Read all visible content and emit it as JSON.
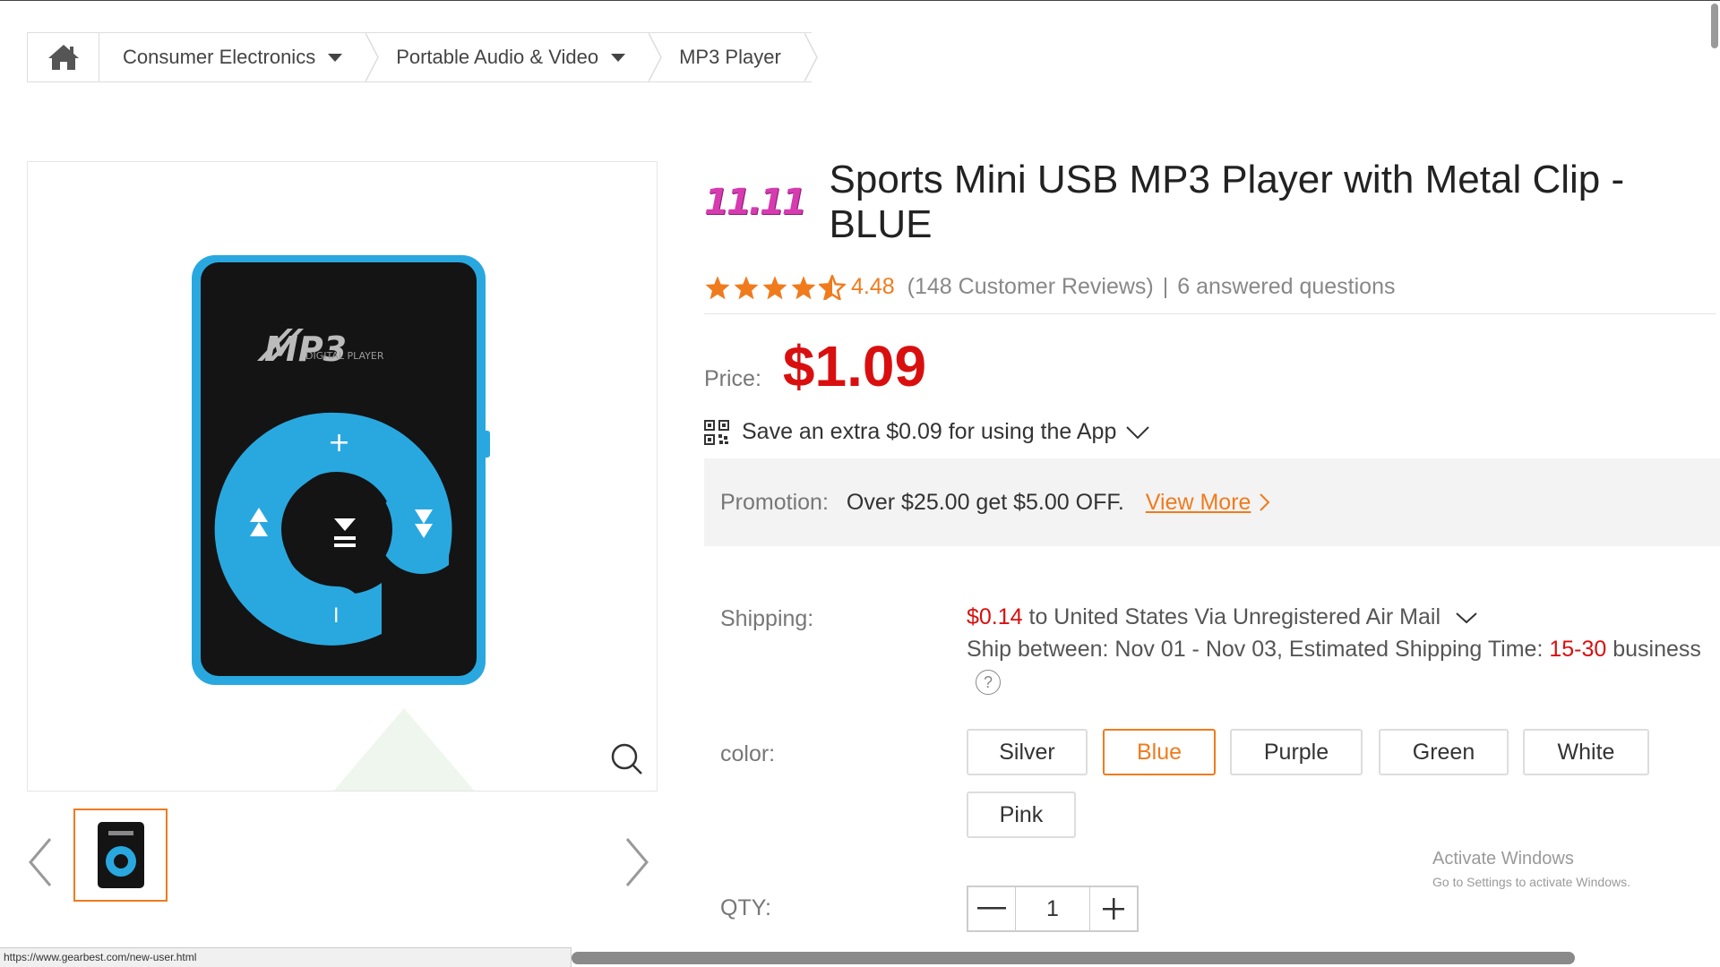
{
  "breadcrumb": {
    "items": [
      {
        "label": "Consumer Electronics"
      },
      {
        "label": "Portable Audio & Video"
      },
      {
        "label": "MP3 Player"
      }
    ]
  },
  "gallery": {
    "image_alt_brand": "MP3",
    "image_alt_sub": "DIGITAL PLAYER"
  },
  "product": {
    "promo_badge": "11.11",
    "title": "Sports Mini USB MP3 Player with Metal Clip - BLUE",
    "rating": "4.48",
    "rating_value": 4.48,
    "rating_max": 5,
    "reviews": "(148 Customer Reviews)",
    "separator": "|",
    "questions": "6 answered questions",
    "price_label": "Price:",
    "price": "$1.09",
    "app_text": "Save an extra $0.09 for using the App"
  },
  "promotion": {
    "label": "Promotion:",
    "text": "Over $25.00 get $5.00 OFF.",
    "link": "View More"
  },
  "shipping": {
    "label": "Shipping:",
    "cost": "$0.14",
    "route": " to United States Via Unregistered Air Mail",
    "ship_between_prefix": "Ship between: Nov 01 - Nov 03, Estimated Shipping Time: ",
    "ship_time": "15-30",
    "ship_suffix": " business",
    "help": "?"
  },
  "color": {
    "label": "color:",
    "options": [
      "Silver",
      "Blue",
      "Purple",
      "Green",
      "White",
      "Pink"
    ],
    "selected": "Blue"
  },
  "qty": {
    "label": "QTY:",
    "value": "1"
  },
  "watermark": {
    "line1": "Activate Windows",
    "line2": "Go to Settings to activate Windows."
  },
  "status_url": "https://www.gearbest.com/new-user.html",
  "colors": {
    "accent": "#f07b1d",
    "price_red": "#d90f0f",
    "badge_pink": "#d63bb0",
    "player_blue": "#29a8e0"
  }
}
